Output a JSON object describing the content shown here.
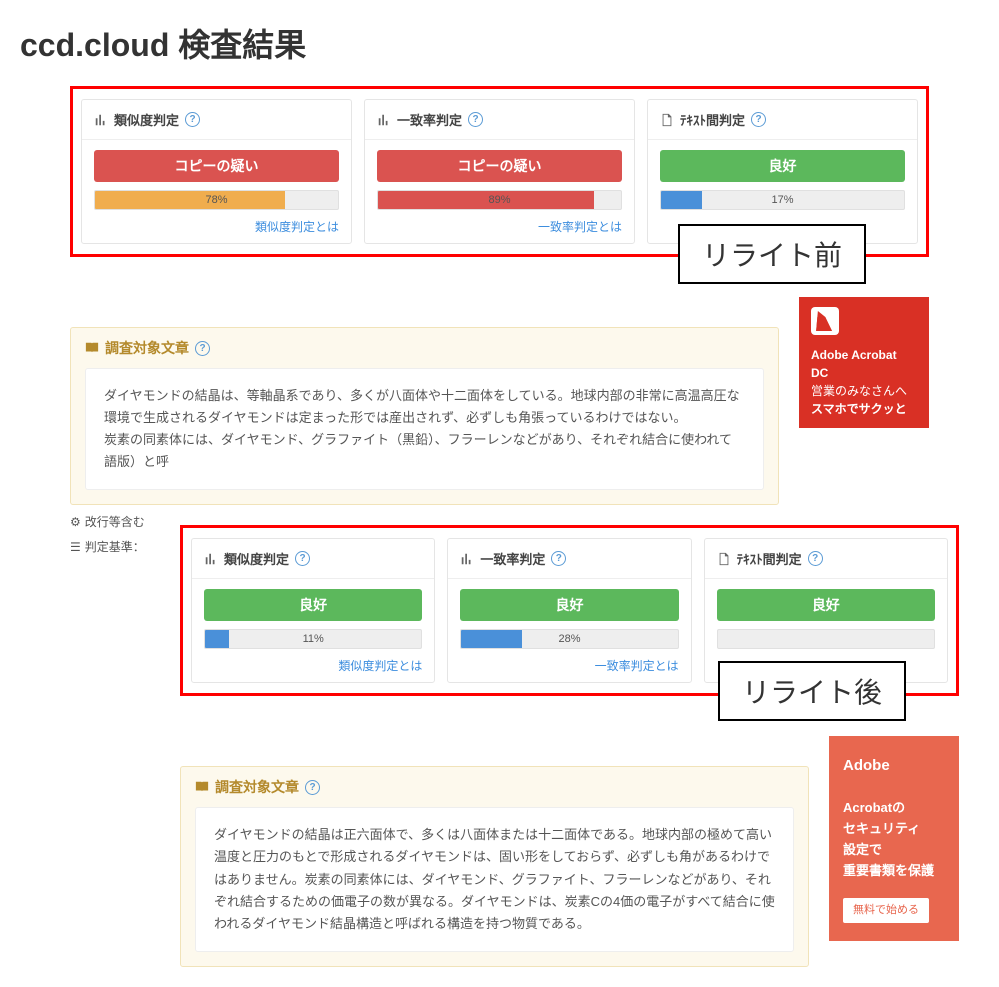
{
  "page_title": "ccd.cloud 検査結果",
  "before": {
    "label": "リライト前",
    "cards": [
      {
        "title": "類似度判定",
        "status": "コピーの疑い",
        "status_class": "status-red",
        "percent": 78,
        "percent_label": "78%",
        "fill_class": "prog-orange",
        "link": "類似度判定とは"
      },
      {
        "title": "一致率判定",
        "status": "コピーの疑い",
        "status_class": "status-red",
        "percent": 89,
        "percent_label": "89%",
        "fill_class": "prog-red",
        "link": "一致率判定とは"
      },
      {
        "title": "ﾃｷｽﾄ間判定",
        "status": "良好",
        "status_class": "status-green",
        "percent": 17,
        "percent_label": "17%",
        "fill_class": "prog-blue",
        "link": ""
      }
    ]
  },
  "after": {
    "label": "リライト後",
    "cards": [
      {
        "title": "類似度判定",
        "status": "良好",
        "status_class": "status-green",
        "percent": 11,
        "percent_label": "11%",
        "fill_class": "prog-blue",
        "link": "類似度判定とは"
      },
      {
        "title": "一致率判定",
        "status": "良好",
        "status_class": "status-green",
        "percent": 28,
        "percent_label": "28%",
        "fill_class": "prog-blue",
        "link": "一致率判定とは"
      },
      {
        "title": "ﾃｷｽﾄ間判定",
        "status": "良好",
        "status_class": "status-green",
        "percent": 0,
        "percent_label": "",
        "fill_class": "prog-blue",
        "link": ""
      }
    ]
  },
  "target_section": {
    "title": "調査対象文章",
    "text1": "ダイヤモンドの結晶は、等軸晶系であり、多くが八面体や十二面体をしている。地球内部の非常に高温高圧な環境で生成されるダイヤモンドは定まった形では産出されず、必ずしも角張っているわけではない。\n炭素の同素体には、ダイヤモンド、グラファイト（黒鉛）、フラーレンなどがあり、それぞれ結合に使われて\n語版）と呼",
    "text2": "ダイヤモンドの結晶は正六面体で、多くは八面体または十二面体である。地球内部の極めて高い温度と圧力のもとで形成されるダイヤモンドは、固い形をしておらず、必ずしも角があるわけではありません。炭素の同素体には、ダイヤモンド、グラファイト、フラーレンなどがあり、それぞれ結合するための価電子の数が異なる。ダイヤモンドは、炭素Cの4価の電子がすべて結合に使われるダイヤモンド結晶構造と呼ばれる構造を持つ物質である。"
  },
  "meta": {
    "line1": "改行等含む",
    "line2": "判定基準："
  },
  "ad1": {
    "title": "Adobe Acrobat DC",
    "sub1": "営業のみなさんへ",
    "sub2": "スマホでサクッと"
  },
  "ad2": {
    "brand": "Adobe",
    "line1": "Acrobatの",
    "line2": "セキュリティ",
    "line3": "設定で",
    "line4": "重要書類を保護",
    "cta": "無料で始める"
  }
}
